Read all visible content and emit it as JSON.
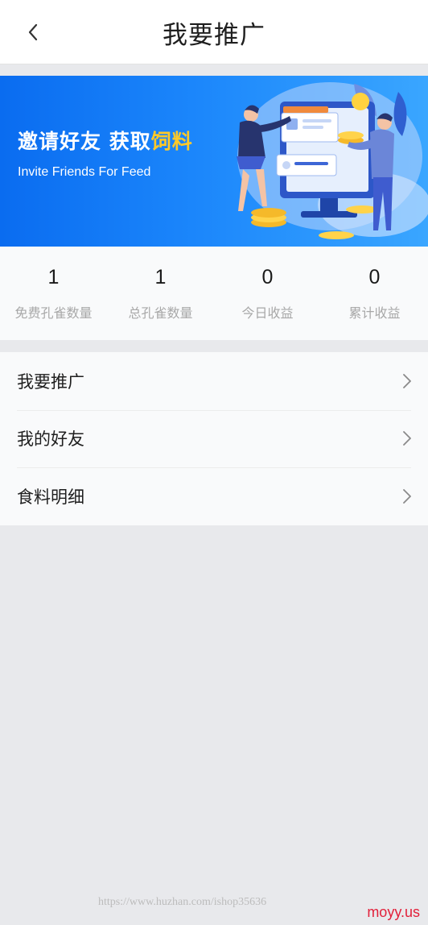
{
  "header": {
    "back_icon": "chevron-left-icon",
    "title": "我要推广"
  },
  "banner": {
    "title_prefix": "邀请好友  获取",
    "title_highlight": "饲料",
    "subtitle": "Invite Friends For Feed",
    "highlight_color": "#ffc928"
  },
  "stats": [
    {
      "value": "1",
      "label": "免费孔雀数量"
    },
    {
      "value": "1",
      "label": "总孔雀数量"
    },
    {
      "value": "0",
      "label": "今日收益"
    },
    {
      "value": "0",
      "label": "累计收益"
    }
  ],
  "menu": {
    "items": [
      {
        "label": "我要推广",
        "icon": "chevron-right-icon"
      },
      {
        "label": "我的好友",
        "icon": "chevron-right-icon"
      },
      {
        "label": "食料明细",
        "icon": "chevron-right-icon"
      }
    ]
  },
  "watermark": "https://www.huzhan.com/ishop35636",
  "corner_logo": "moyy.us"
}
